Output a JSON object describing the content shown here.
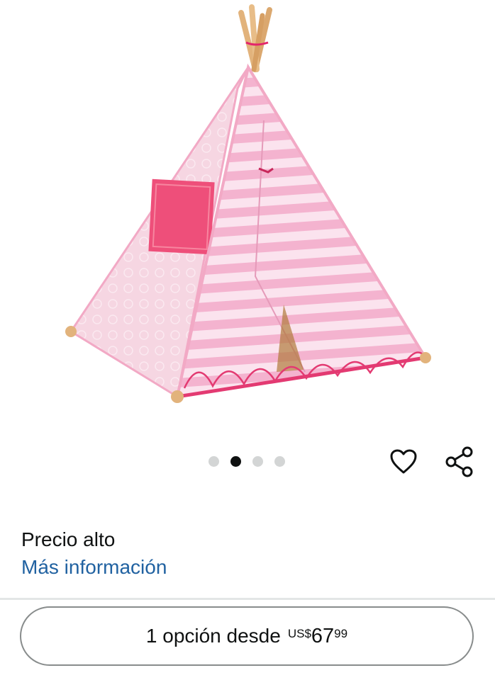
{
  "product": {
    "image_alt": "teepee-tent",
    "carousel": {
      "count": 4,
      "active_index": 1
    }
  },
  "actions": {
    "wishlist_icon": "heart-outline-icon",
    "share_icon": "share-icon"
  },
  "pricing": {
    "label": "Precio alto",
    "more_info_link": "Más información"
  },
  "offers_button": {
    "label": "1 opción desde",
    "currency": "US$",
    "whole": "67",
    "fraction": "99"
  },
  "colors": {
    "link": "#2162a1",
    "text": "#0f1111",
    "border": "#888c8c",
    "dot_active": "#0f1111",
    "dot_inactive": "#d3d5d5"
  }
}
